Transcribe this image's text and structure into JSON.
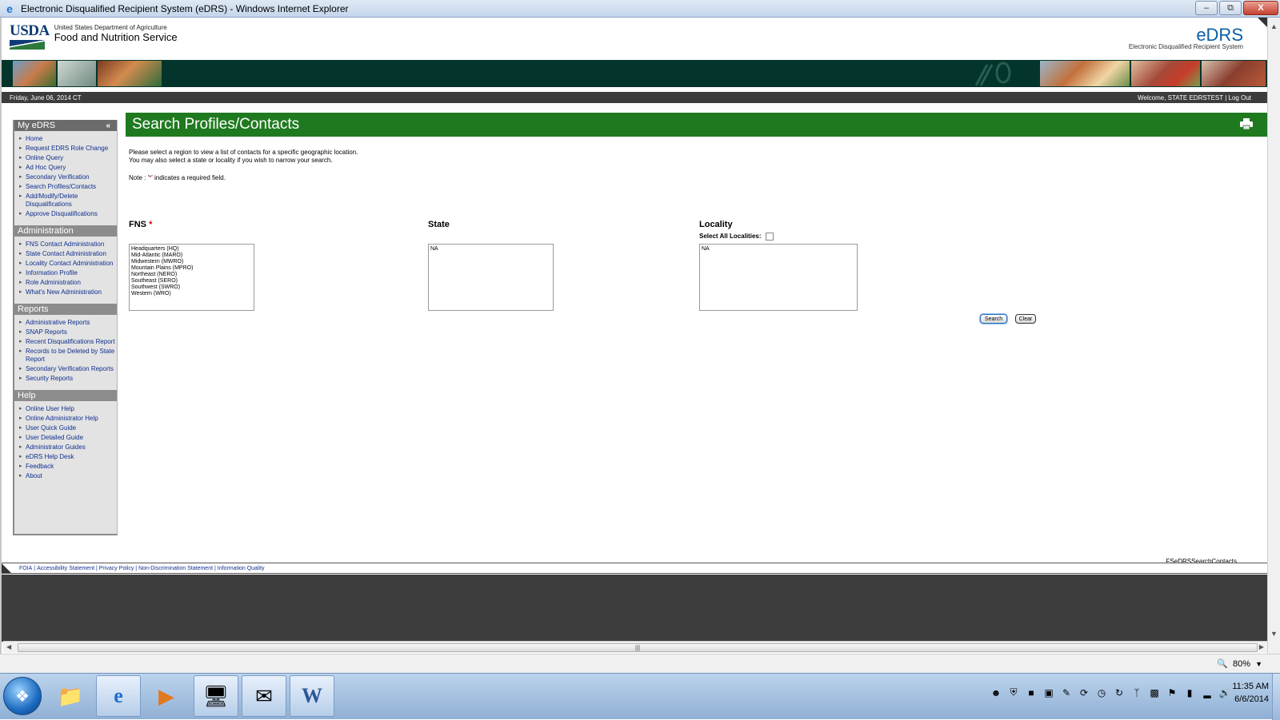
{
  "window": {
    "title": "Electronic Disqualified Recipient System (eDRS) - Windows Internet Explorer",
    "min_label": "–",
    "restore_label": "⧉",
    "close_label": "X"
  },
  "header": {
    "usda_text": "USDA",
    "dept": "United States Department of Agriculture",
    "agency": "Food and Nutrition Service",
    "edrs_logo": "eDRS",
    "edrs_tagline": "Electronic Disqualified Recipient System"
  },
  "infobar": {
    "date": "Friday, June 06, 2014 CT",
    "welcome": "Welcome, STATE EDRSTEST",
    "separator": "|",
    "logout": "Log Out"
  },
  "sidebar": {
    "my_edrs": {
      "title": "My eDRS",
      "collapse": "«",
      "items": [
        "Home",
        "Request EDRS Role Change",
        "Online Query",
        "Ad Hoc Query",
        "Secondary Verification",
        "Search Profiles/Contacts",
        "Add/Modify/Delete Disqualifications",
        "Approve Disqualifications"
      ]
    },
    "administration": {
      "title": "Administration",
      "items": [
        "FNS Contact Administration",
        "State Contact Administration",
        "Locality Contact Administration",
        "Information Profile",
        "Role Administration",
        "What's New Administration"
      ]
    },
    "reports": {
      "title": "Reports",
      "items": [
        "Administrative Reports",
        "SNAP Reports",
        "Recent Disqualifications Report",
        "Records to be Deleted by State Report",
        "Secondary Verification Reports",
        "Security Reports"
      ]
    },
    "help": {
      "title": "Help",
      "items": [
        "Online User Help",
        "Online Administrator Help",
        "User Quick Guide",
        "User Detailed Guide",
        "Administrator Guides",
        "eDRS Help Desk",
        "Feedback",
        "About"
      ]
    }
  },
  "main": {
    "title": "Search Profiles/Contacts",
    "intro_line1": "Please select a region to view a list of contacts for a specific geographic location.",
    "intro_line2": "You may also select a state or locality if you wish to narrow your search.",
    "note_prefix": "Note : '",
    "note_star": "*",
    "note_suffix": "' indicates a required field.",
    "fns": {
      "label": "FNS",
      "required": "*",
      "options": [
        "Headquarters (HQ)",
        "Mid-Atlantic (MARO)",
        "Midwestern (MWRO)",
        "Mountain Plains (MPRO)",
        "Northeast (NERO)",
        "Southeast (SERO)",
        "Southwest (SWRO)",
        "Western (WRO)"
      ]
    },
    "state": {
      "label": "State",
      "options": [
        "NA"
      ]
    },
    "locality": {
      "label": "Locality",
      "select_all_label": "Select All Localities:",
      "options": [
        "NA"
      ]
    },
    "search_button": "Search",
    "clear_button": "Clear",
    "screen_id": "FSeDRSSearchContacts"
  },
  "footer": {
    "links": [
      "FOIA",
      "Accessibility Statement",
      "Privacy Policy",
      "Non-Discrimination Statement",
      "Information Quality"
    ],
    "separator": " | "
  },
  "hscroll": {
    "grip": "|||"
  },
  "statusbar": {
    "zoom": "80%",
    "zoom_arrow": "▼"
  },
  "taskbar": {
    "time": "11:35 AM",
    "date": "6/6/2014"
  },
  "colors": {
    "green_header": "#1f7a1f",
    "banner": "#04352c",
    "link": "#0f2f8e",
    "required": "#d00000"
  }
}
